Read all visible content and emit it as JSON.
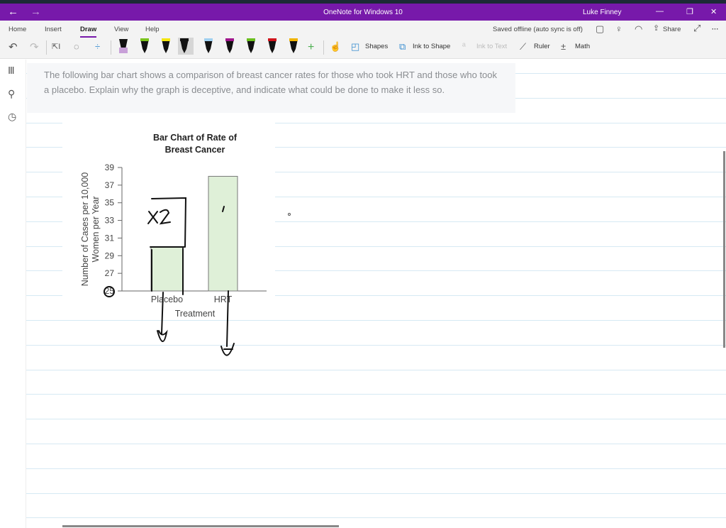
{
  "window": {
    "title": "OneNote for Windows 10",
    "user": "Luke Finney",
    "back": "←",
    "forward": "→",
    "minimize": "—",
    "maximize": "❐",
    "close": "✕"
  },
  "ribbon": {
    "tabs": [
      {
        "label": "Home"
      },
      {
        "label": "Insert"
      },
      {
        "label": "Draw",
        "active": true
      },
      {
        "label": "View"
      },
      {
        "label": "Help"
      }
    ],
    "status": "Saved offline (auto sync is off)",
    "share": "Share",
    "more": "···",
    "tools": {
      "shapes": "Shapes",
      "ink_to_shape": "Ink to Shape",
      "ink_to_text": "Ink to Text",
      "ruler": "Ruler",
      "math": "Math"
    },
    "pens": [
      {
        "color": "#c8a0d8",
        "type": "eraser"
      },
      {
        "color": "#7ac41c"
      },
      {
        "color": "#f4e60f",
        "type": "highlighter"
      },
      {
        "color": "#111111",
        "selected": true
      },
      {
        "color": "#9fd0f0",
        "type": "highlighter"
      },
      {
        "color": "#a0168c"
      },
      {
        "color": "#6bbf1f"
      },
      {
        "color": "#d0141c"
      },
      {
        "color": "#f0b400"
      }
    ]
  },
  "question": "The following bar chart shows a comparison of breast cancer rates for those who took HRT and those who took a placebo. Explain why the graph is deceptive, and indicate what could be done to make it less so.",
  "chart_data": {
    "type": "bar",
    "title": "Bar Chart of Rate of Breast Cancer",
    "title_lines": [
      "Bar Chart of Rate of",
      "Breast Cancer"
    ],
    "categories": [
      "Placebo",
      "HRT"
    ],
    "values": [
      30,
      38
    ],
    "xlabel": "Treatment",
    "ylabel_lines": [
      "Number of Cases per 10,000",
      "Women per Year"
    ],
    "ylim": [
      25,
      39
    ],
    "yticks": [
      25,
      27,
      29,
      31,
      33,
      35,
      37,
      39
    ],
    "bar_color": "#dff0d8",
    "grid": false
  },
  "annotations": {
    "ink_text": "x2",
    "ink_mark": "/"
  }
}
